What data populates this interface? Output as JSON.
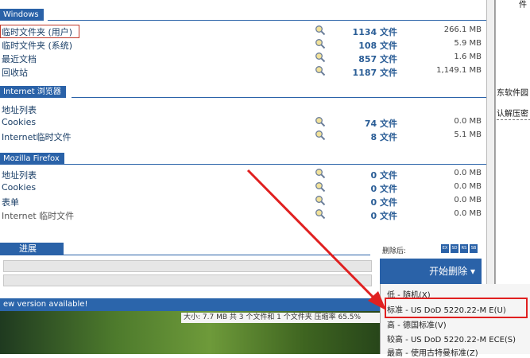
{
  "sections": {
    "windows": {
      "title": "Windows",
      "rows": [
        {
          "name": "临时文件夹 (用户)",
          "count": "1134 文件",
          "size": "266.1 MB"
        },
        {
          "name": "临时文件夹 (系统)",
          "count": "108 文件",
          "size": "5.9 MB"
        },
        {
          "name": "最近文档",
          "count": "857 文件",
          "size": "1.6 MB"
        },
        {
          "name": "回收站",
          "count": "1187 文件",
          "size": "1,149.1 MB"
        }
      ]
    },
    "ie": {
      "title": "Internet 浏览器",
      "rows": [
        {
          "name": "地址列表",
          "count": "",
          "size": ""
        },
        {
          "name": "Cookies",
          "count": "74 文件",
          "size": "0.0 MB"
        },
        {
          "name": "Internet临时文件",
          "count": "8 文件",
          "size": "5.1 MB"
        }
      ]
    },
    "firefox": {
      "title": "Mozilla Firefox",
      "rows": [
        {
          "name": "地址列表",
          "count": "0 文件",
          "size": "0.0 MB"
        },
        {
          "name": "Cookies",
          "count": "0 文件",
          "size": "0.0 MB"
        },
        {
          "name": "表单",
          "count": "0 文件",
          "size": "0.0 MB"
        },
        {
          "name": "Internet 临时文件",
          "count": "0 文件",
          "size": "0.0 MB"
        }
      ]
    }
  },
  "progress": {
    "title": "进展",
    "after_delete_label": "删除后:",
    "mini_buttons": [
      "EX",
      "SD",
      "RS",
      "SB"
    ],
    "start_button": "开始删除 ▾"
  },
  "menu": {
    "items": [
      "低 - 随机(X)",
      "标准 - US DoD 5220.22-M E(U)",
      "高 - 德国标准(V)",
      "较高 - US DoD 5220.22-M ECE(S)",
      "最高 - 使用古特曼标准(Z)"
    ],
    "highlighted_index": 1
  },
  "banner": {
    "text": "ew version available!"
  },
  "info_strip": {
    "text": "大小: 7.7 MB 共 3 个文件和 1 个文件夹 压缩率 65.5%"
  },
  "side_panel": {
    "top": "件",
    "text1": "东软件园",
    "text2": "认解压密"
  },
  "colors": {
    "accent": "#2a62a8",
    "highlight": "#e02020"
  },
  "icons": {
    "row_icon": "magnifier-icon"
  }
}
